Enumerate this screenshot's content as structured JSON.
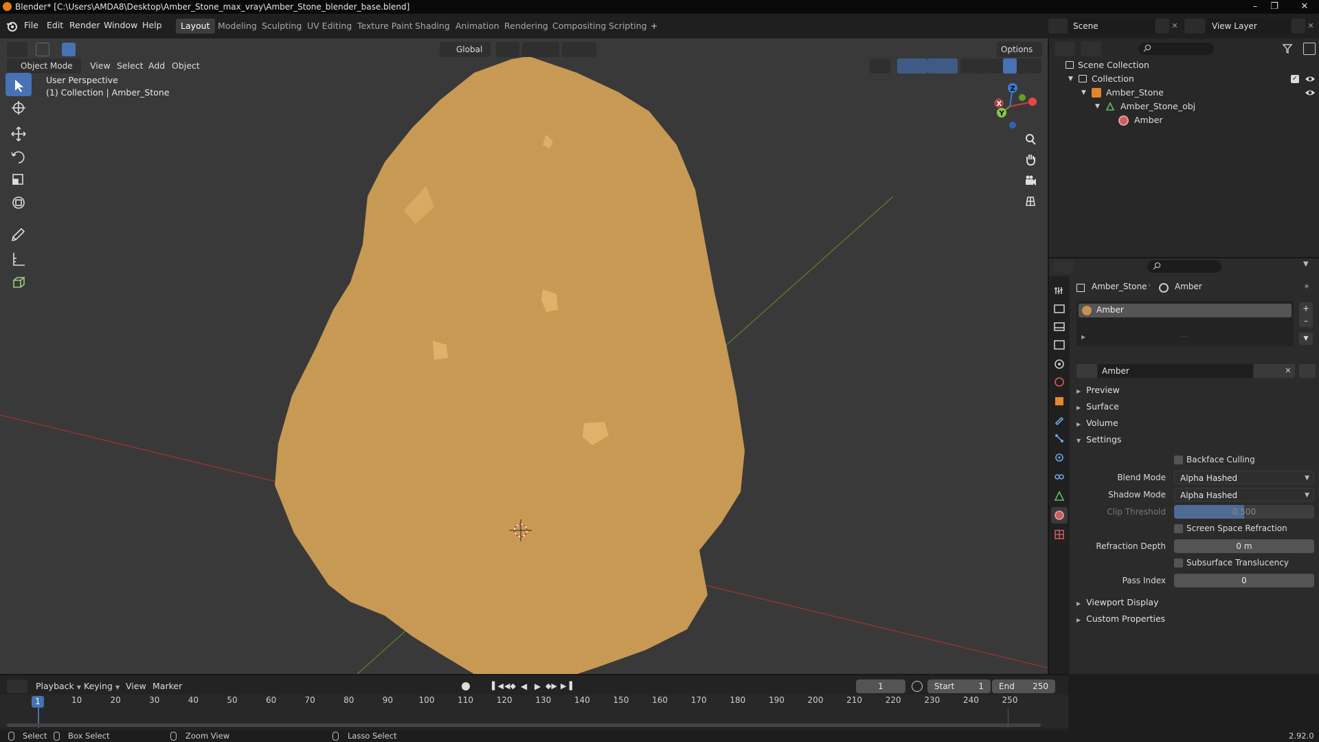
{
  "window": {
    "title": "Blender* [C:\\Users\\AMDA8\\Desktop\\Amber_Stone_max_vray\\Amber_Stone_blender_base.blend]"
  },
  "menu": [
    "File",
    "Edit",
    "Render",
    "Window",
    "Help"
  ],
  "workspaces": [
    "Layout",
    "Modeling",
    "Sculpting",
    "UV Editing",
    "Texture Paint",
    "Shading",
    "Animation",
    "Rendering",
    "Compositing",
    "Scripting"
  ],
  "scene": {
    "label": "Scene",
    "view_layer": "View Layer"
  },
  "viewport": {
    "transform": "Global",
    "options": "Options",
    "mode": "Object Mode",
    "menus": [
      "View",
      "Select",
      "Add",
      "Object"
    ],
    "info_line1": "User Perspective",
    "info_line2": "(1) Collection | Amber_Stone",
    "gizmo_axes": [
      "X",
      "Y",
      "Z"
    ],
    "colors": {
      "stone": "#d4a256",
      "x_axis": "#cc3b3b",
      "y_axis": "#6a9a2a",
      "z_axis": "#3b7dd8"
    }
  },
  "outliner": {
    "search_placeholder": "",
    "rows": [
      {
        "label": "Scene Collection"
      },
      {
        "label": "Collection"
      },
      {
        "label": "Amber_Stone"
      },
      {
        "label": "Amber_Stone_obj"
      },
      {
        "label": "Amber"
      }
    ]
  },
  "properties": {
    "breadcrumb_object": "Amber_Stone",
    "breadcrumb_material": "Amber",
    "slot_material": "Amber",
    "material_name": "Amber",
    "panels": {
      "preview": "Preview",
      "surface": "Surface",
      "volume": "Volume",
      "settings": "Settings",
      "viewport_display": "Viewport Display",
      "custom_properties": "Custom Properties"
    },
    "settings": {
      "backface_culling": "Backface Culling",
      "blend_mode_label": "Blend Mode",
      "blend_mode": "Alpha Hashed",
      "shadow_mode_label": "Shadow Mode",
      "shadow_mode": "Alpha Hashed",
      "clip_threshold_label": "Clip Threshold",
      "clip_threshold": "0.500",
      "ssr": "Screen Space Refraction",
      "refraction_depth_label": "Refraction Depth",
      "refraction_depth": "0 m",
      "subsurface": "Subsurface Translucency",
      "pass_index_label": "Pass Index",
      "pass_index": "0"
    }
  },
  "timeline": {
    "menus": [
      "Playback",
      "Keying",
      "View",
      "Marker"
    ],
    "current_frame": "1",
    "start_label": "Start",
    "start": "1",
    "end_label": "End",
    "end": "250",
    "ticks": [
      "1",
      "10",
      "20",
      "30",
      "40",
      "50",
      "60",
      "70",
      "80",
      "90",
      "100",
      "110",
      "120",
      "130",
      "140",
      "150",
      "160",
      "170",
      "180",
      "190",
      "200",
      "210",
      "220",
      "230",
      "240",
      "250"
    ]
  },
  "status": {
    "select": "Select",
    "box_select": "Box Select",
    "zoom_view": "Zoom View",
    "lasso_select": "Lasso Select",
    "version": "2.92.0"
  }
}
